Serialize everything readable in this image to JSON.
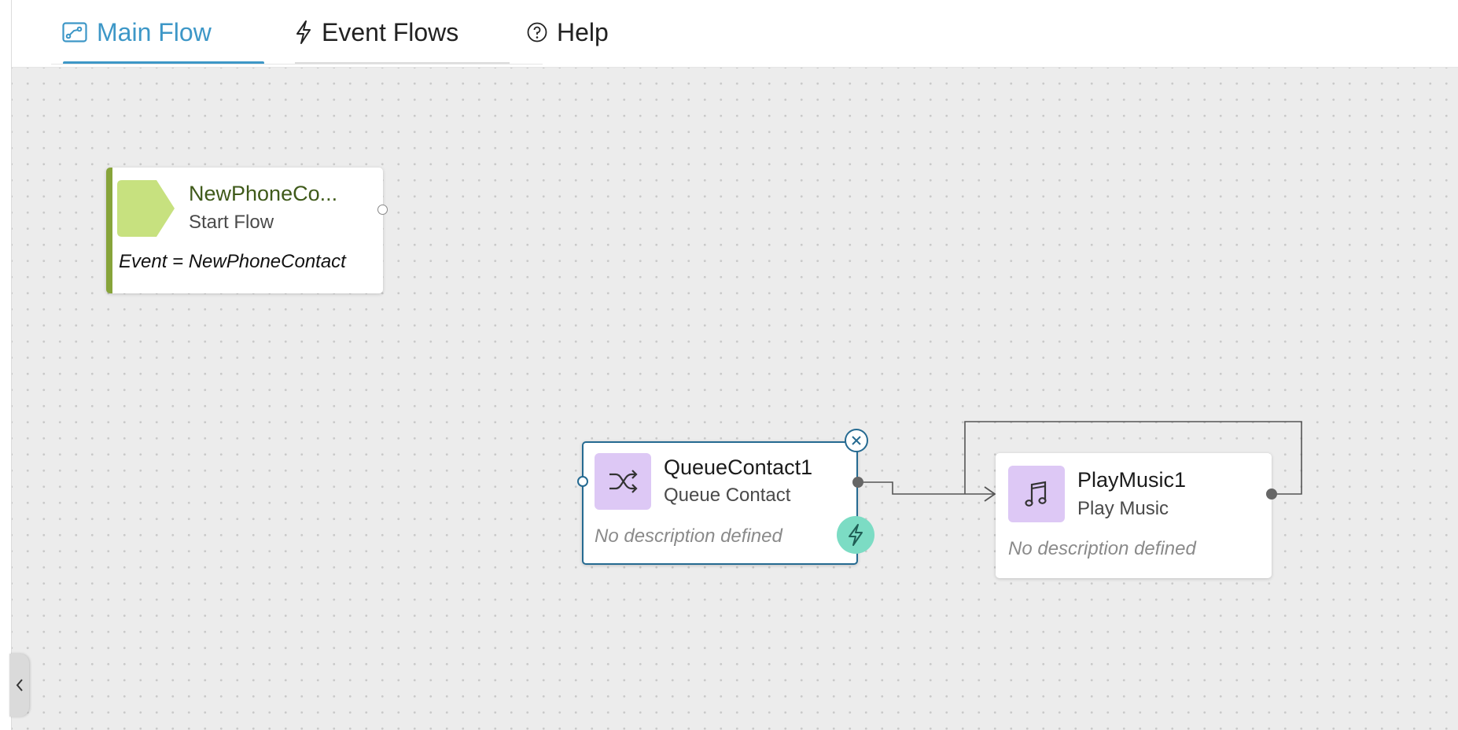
{
  "tabs": {
    "main_flow": {
      "label": "Main Flow",
      "icon": "flow-diagram-icon",
      "active": true
    },
    "event_flows": {
      "label": "Event Flows",
      "icon": "lightning-icon"
    },
    "help": {
      "label": "Help",
      "icon": "question-circle-icon"
    }
  },
  "nodes": {
    "start": {
      "title": "NewPhoneCo...",
      "type": "Start Flow",
      "event": "Event = NewPhoneContact",
      "icon": "start-arrow-shape",
      "accent_color": "#87a43a",
      "icon_color": "#c7e17f"
    },
    "queue": {
      "title": "QueueContact1",
      "type": "Queue Contact",
      "description": "No description defined",
      "icon": "shuffle-icon",
      "selected": true
    },
    "music": {
      "title": "PlayMusic1",
      "type": "Play Music",
      "description": "No description defined",
      "icon": "music-note-icon"
    }
  },
  "colors": {
    "active_tab": "#3d97c7",
    "selection_border": "#256a91",
    "icon_bg": "#ddc8f5",
    "event_button": "#7cdcc4",
    "canvas_bg": "#ececec"
  }
}
